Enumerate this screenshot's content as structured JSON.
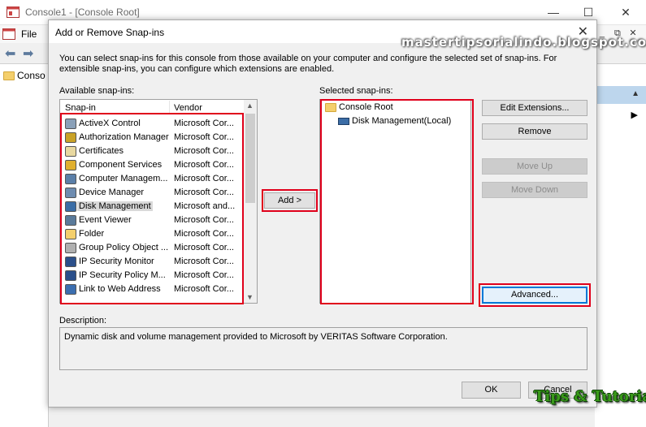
{
  "console": {
    "title": "Console1 - [Console Root]",
    "menu_file": "File",
    "tree_item": "Conso",
    "minimize": "—",
    "maximize": "☐",
    "close": "✕",
    "mdi_minimize": "_",
    "mdi_restore": "⧉",
    "mdi_close": "✕"
  },
  "dialog": {
    "title": "Add or Remove Snap-ins",
    "close": "✕",
    "intro": "You can select snap-ins for this console from those available on your computer and configure the selected set of snap-ins. For extensible snap-ins, you can configure which extensions are enabled.",
    "available_label": "Available snap-ins:",
    "selected_label": "Selected snap-ins:",
    "columns": {
      "snapin": "Snap-in",
      "vendor": "Vendor"
    },
    "available": [
      {
        "name": "ActiveX Control",
        "vendor": "Microsoft Cor...",
        "icon": "activex-icon",
        "color": "#8aa0b8"
      },
      {
        "name": "Authorization Manager",
        "vendor": "Microsoft Cor...",
        "icon": "authorization-icon",
        "color": "#c9a227"
      },
      {
        "name": "Certificates",
        "vendor": "Microsoft Cor...",
        "icon": "certificate-icon",
        "color": "#e8d8a0"
      },
      {
        "name": "Component Services",
        "vendor": "Microsoft Cor...",
        "icon": "component-icon",
        "color": "#e0b030"
      },
      {
        "name": "Computer Managem...",
        "vendor": "Microsoft Cor...",
        "icon": "computer-icon",
        "color": "#5b7fa8"
      },
      {
        "name": "Device Manager",
        "vendor": "Microsoft Cor...",
        "icon": "device-icon",
        "color": "#6e8cb0"
      },
      {
        "name": "Disk Management",
        "vendor": "Microsoft and...",
        "icon": "disk-icon",
        "color": "#3b6da6"
      },
      {
        "name": "Event Viewer",
        "vendor": "Microsoft Cor...",
        "icon": "event-icon",
        "color": "#5a7a9a"
      },
      {
        "name": "Folder",
        "vendor": "Microsoft Cor...",
        "icon": "folder-icon",
        "color": "#f4cf6c"
      },
      {
        "name": "Group Policy Object ...",
        "vendor": "Microsoft Cor...",
        "icon": "policy-icon",
        "color": "#b0b0b0"
      },
      {
        "name": "IP Security Monitor",
        "vendor": "Microsoft Cor...",
        "icon": "ipsec-icon",
        "color": "#2b4f8a"
      },
      {
        "name": "IP Security Policy M...",
        "vendor": "Microsoft Cor...",
        "icon": "ipsec-policy-icon",
        "color": "#2b4f8a"
      },
      {
        "name": "Link to Web Address",
        "vendor": "Microsoft Cor...",
        "icon": "web-link-icon",
        "color": "#3c6fb0"
      }
    ],
    "selected_index": 6,
    "selected_tree": [
      {
        "name": "Console Root",
        "icon": "folder-icon"
      },
      {
        "name": "Disk Management(Local)",
        "icon": "disk-icon"
      }
    ],
    "buttons": {
      "add": "Add >",
      "edit_extensions": "Edit Extensions...",
      "remove": "Remove",
      "move_up": "Move Up",
      "move_down": "Move Down",
      "advanced": "Advanced...",
      "ok": "OK",
      "cancel": "Cancel"
    },
    "description_label": "Description:",
    "description": "Dynamic disk and volume management provided to Microsoft by VERITAS Software Corporation."
  },
  "watermark": "mastertipsorialindo.blogspot.com",
  "logo": "Tips & Tutorial",
  "colors": {
    "highlight_box": "#e0001b",
    "default_button_border": "#0078d7"
  }
}
